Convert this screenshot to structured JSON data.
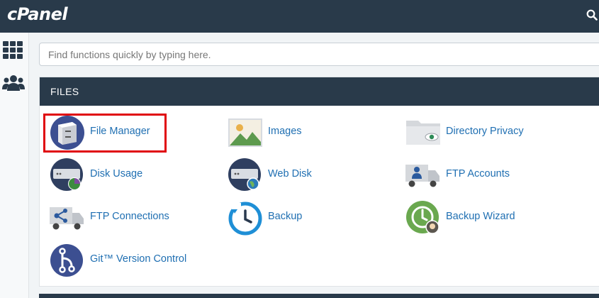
{
  "app": {
    "logo": "cPanel"
  },
  "search": {
    "placeholder": "Find functions quickly by typing here."
  },
  "section": {
    "title": "FILES"
  },
  "items": [
    {
      "label": "File Manager",
      "icon": "file-manager-icon"
    },
    {
      "label": "Images",
      "icon": "images-icon"
    },
    {
      "label": "Directory Privacy",
      "icon": "directory-privacy-icon"
    },
    {
      "label": "Disk Usage",
      "icon": "disk-usage-icon"
    },
    {
      "label": "Web Disk",
      "icon": "web-disk-icon"
    },
    {
      "label": "FTP Accounts",
      "icon": "ftp-accounts-icon"
    },
    {
      "label": "FTP Connections",
      "icon": "ftp-connections-icon"
    },
    {
      "label": "Backup",
      "icon": "backup-icon"
    },
    {
      "label": "Backup Wizard",
      "icon": "backup-wizard-icon"
    },
    {
      "label": "Git™ Version Control",
      "icon": "git-icon"
    }
  ],
  "colors": {
    "header": "#293a4a",
    "link": "#1f6fb2",
    "highlight": "#e0060e"
  }
}
